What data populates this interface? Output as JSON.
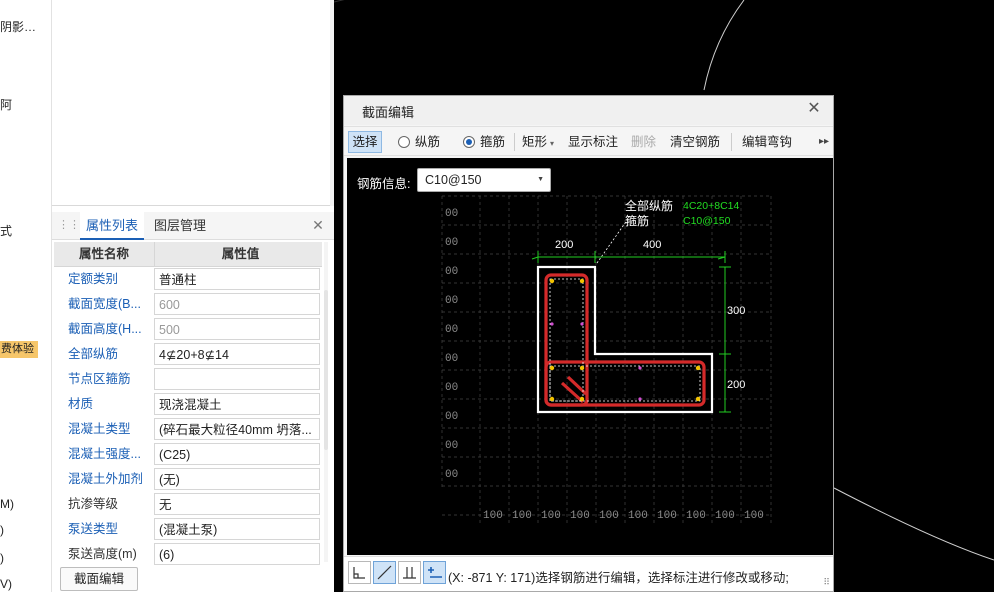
{
  "left_strip": {
    "items": [
      "阴影…",
      "阿",
      "式",
      "M)",
      ")",
      ")",
      "V)"
    ],
    "badge": "费体验"
  },
  "property_panel": {
    "tabs": [
      "属性列表",
      "图层管理"
    ],
    "close": "✕",
    "header": {
      "name": "属性名称",
      "value": "属性值"
    },
    "rows": [
      {
        "name": "定额类别",
        "value": "普通柱"
      },
      {
        "name": "截面宽度(B...",
        "value": "600"
      },
      {
        "name": "截面高度(H...",
        "value": "500"
      },
      {
        "name": "全部纵筋",
        "value": "4⊈20+8⊈14"
      },
      {
        "name": "节点区箍筋",
        "value": ""
      },
      {
        "name": "材质",
        "value": "现浇混凝土"
      },
      {
        "name": "混凝土类型",
        "value": "(碎石最大粒径40mm 坍落..."
      },
      {
        "name": "混凝土强度...",
        "value": "(C25)"
      },
      {
        "name": "混凝土外加剂",
        "value": "(无)"
      },
      {
        "name": "抗渗等级",
        "value": "无"
      },
      {
        "name": "泵送类型",
        "value": "(混凝土泵)"
      },
      {
        "name": "泵送高度(m)",
        "value": "(6)"
      }
    ],
    "section_edit_button": "截面编辑"
  },
  "dialog": {
    "title": "截面编辑",
    "close": "✕",
    "toolbar": {
      "select": "选择",
      "longitudinal": "纵筋",
      "stirrup": "箍筋",
      "shape": "矩形",
      "show_dims": "显示标注",
      "delete": "删除",
      "clear": "清空钢筋",
      "edit_hook": "编辑弯钩",
      "more": "▸▸"
    },
    "rebar_info_label": "钢筋信息:",
    "rebar_info_value": "C10@150",
    "drawing": {
      "callout_1": "全部纵筋",
      "callout_2": "箍筋",
      "green_1": "4C20+8C14",
      "green_2": "C10@150",
      "dim_top_left": "200",
      "dim_top_right": "400",
      "dim_right_top": "300",
      "dim_right_bottom": "200",
      "grid_left_label": "00",
      "grid_bottom_label": "100"
    },
    "status_text": "(X: -871 Y: 171)选择钢筋进行编辑，选择标注进行修改或移动;",
    "accent": "#1b5fb5",
    "rebar_color": "#d42a2a",
    "dim_color": "#22cc22"
  }
}
